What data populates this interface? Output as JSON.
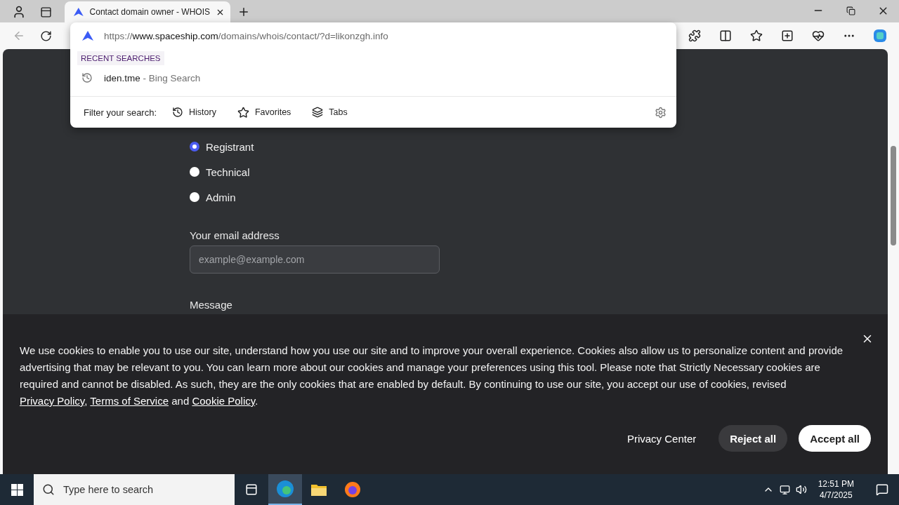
{
  "browser": {
    "tabs": [
      {
        "title": "Contact domain owner - WHOIS",
        "selected": true
      }
    ],
    "address": {
      "prefix": "https://",
      "host": "www.spaceship.com",
      "path": "/domains/whois/contact/?d=likonzgh.info"
    },
    "suggestions": {
      "heading": "RECENT SEARCHES",
      "items": [
        {
          "query": "iden.tme",
          "source": "- Bing Search"
        }
      ],
      "filter_label": "Filter your search:",
      "filters": [
        {
          "kind": "history",
          "label": "History"
        },
        {
          "kind": "favorites",
          "label": "Favorites"
        },
        {
          "kind": "tabs",
          "label": "Tabs"
        }
      ]
    }
  },
  "form": {
    "options": [
      {
        "label": "Registrant",
        "selected": true
      },
      {
        "label": "Technical",
        "selected": false
      },
      {
        "label": "Admin",
        "selected": false
      }
    ],
    "email_label": "Your email address",
    "email_placeholder": "example@example.com",
    "message_label": "Message"
  },
  "cookie_banner": {
    "parts": [
      {
        "kind": "text",
        "text": "We use cookies to enable you to use our site, understand how you use our site and to improve your overall experience. Cookies also allow us to personalize content and provide advertising that may be relevant to you. You can learn more about our cookies and manage your preferences using this tool. Please note that Strictly Necessary cookies are required and cannot be disabled. As such, they are the only cookies that are enabled by default. By continuing to use our site, you accept our use of cookies, revised "
      },
      {
        "kind": "link",
        "text": "Privacy Policy"
      },
      {
        "kind": "text",
        "text": ", "
      },
      {
        "kind": "link",
        "text": "Terms of Service"
      },
      {
        "kind": "text",
        "text": " and "
      },
      {
        "kind": "link",
        "text": "Cookie Policy"
      },
      {
        "kind": "text",
        "text": "."
      }
    ],
    "buttons": [
      {
        "kind": "plain",
        "label": "Privacy Center"
      },
      {
        "kind": "secondary",
        "label": "Reject all"
      },
      {
        "kind": "primary",
        "label": "Accept all"
      }
    ]
  },
  "taskbar": {
    "search_placeholder": "Type here to search",
    "time": "12:51 PM",
    "date": "4/7/2025"
  }
}
